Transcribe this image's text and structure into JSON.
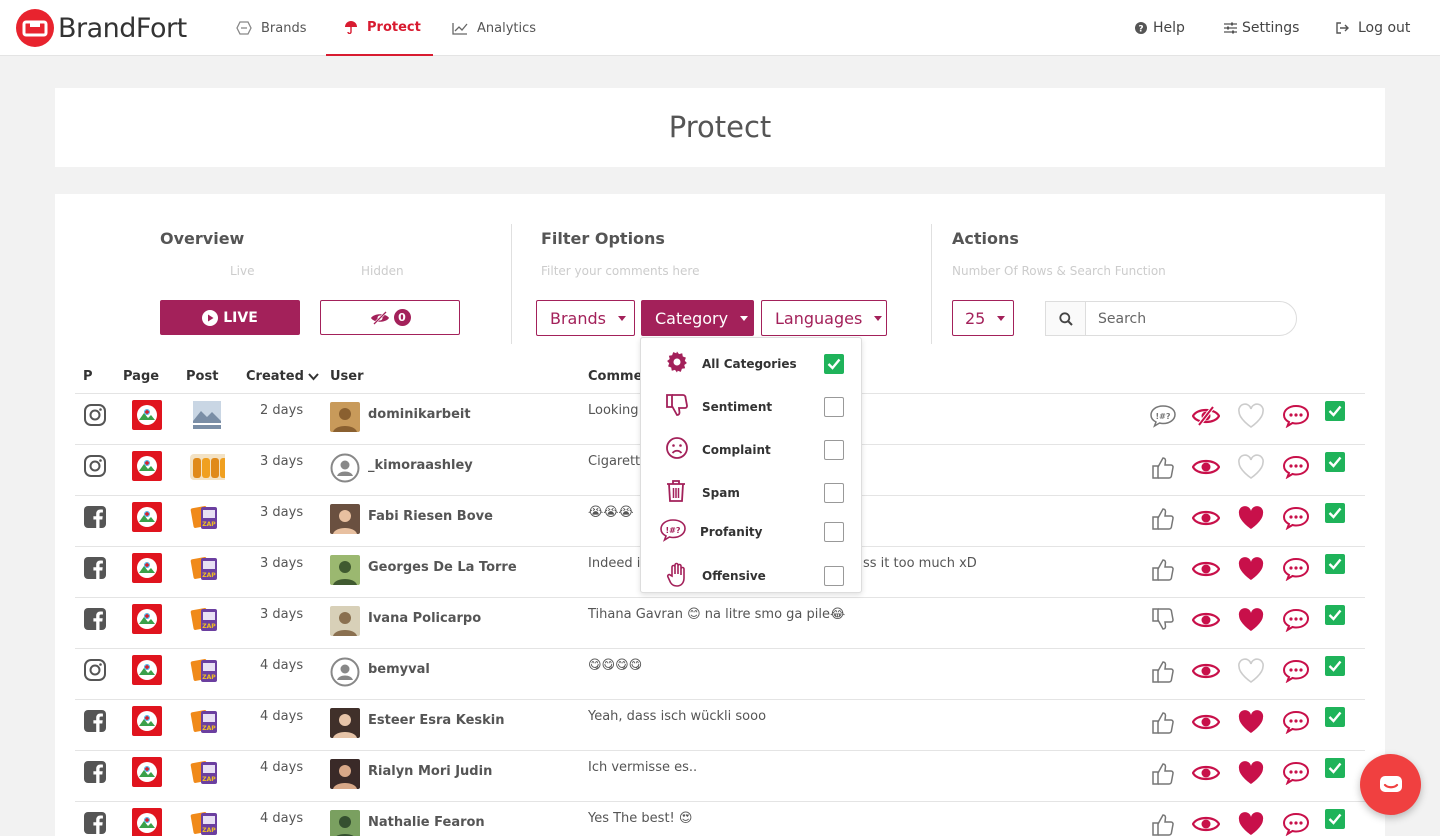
{
  "brand": {
    "name": "BrandFort"
  },
  "nav": {
    "items": [
      {
        "label": "Brands",
        "icon": "brands-icon"
      },
      {
        "label": "Protect",
        "icon": "umbrella-icon",
        "active": true
      },
      {
        "label": "Analytics",
        "icon": "chart-icon"
      }
    ],
    "right": [
      {
        "label": "Help",
        "icon": "help-icon"
      },
      {
        "label": "Settings",
        "icon": "sliders-icon"
      },
      {
        "label": "Log out",
        "icon": "logout-icon"
      }
    ]
  },
  "page": {
    "title": "Protect"
  },
  "overview": {
    "title": "Overview",
    "live_label": "Live",
    "hidden_label": "Hidden",
    "live_button": "LIVE",
    "hidden_count": "0"
  },
  "filters": {
    "title": "Filter Options",
    "subtitle": "Filter your comments here",
    "brands": "Brands",
    "category": "Category",
    "languages": "Languages"
  },
  "actions": {
    "title": "Actions",
    "subtitle": "Number Of Rows & Search Function",
    "rows": "25",
    "search_placeholder": "Search"
  },
  "category_menu": [
    {
      "label": "All Categories",
      "icon": "gear-icon",
      "checked": true
    },
    {
      "label": "Sentiment",
      "icon": "thumbs-down-icon",
      "checked": false
    },
    {
      "label": "Complaint",
      "icon": "frown-icon",
      "checked": false
    },
    {
      "label": "Spam",
      "icon": "trash-icon",
      "checked": false
    },
    {
      "label": "Profanity",
      "icon": "profanity-icon",
      "checked": false
    },
    {
      "label": "Offensive",
      "icon": "hand-icon",
      "checked": false
    }
  ],
  "table": {
    "headers": {
      "p": "P",
      "page": "Page",
      "post": "Post",
      "created": "Created",
      "user": "User",
      "comment": "Comment"
    },
    "rows": [
      {
        "platform": "instagram",
        "created": "2 days",
        "user": "dominikarbeit",
        "comment": "Looking f",
        "sentiment": "profanity",
        "liked": false,
        "hidden": true
      },
      {
        "platform": "instagram",
        "created": "3 days",
        "user": "_kimoraashley",
        "comment": "Cigarette",
        "sentiment": "up",
        "liked": false,
        "hidden": false
      },
      {
        "platform": "facebook",
        "created": "3 days",
        "user": "Fabi Riesen Bove",
        "comment": "😭😭😭",
        "sentiment": "up",
        "liked": true,
        "hidden": false
      },
      {
        "platform": "facebook",
        "created": "3 days",
        "user": "Georges De La Torre",
        "comment": "Indeed it",
        "comment_tail": "ss it too much xD",
        "sentiment": "up",
        "liked": true,
        "hidden": false
      },
      {
        "platform": "facebook",
        "created": "3 days",
        "user": "Ivana Policarpo",
        "comment": "Tihana Gavran 😊 na litre smo ga pile😂",
        "sentiment": "down",
        "liked": true,
        "hidden": false
      },
      {
        "platform": "instagram",
        "created": "4 days",
        "user": "bemyval",
        "comment": "😋😋😋😋",
        "sentiment": "up",
        "liked": false,
        "hidden": false
      },
      {
        "platform": "facebook",
        "created": "4 days",
        "user": "Esteer Esra Keskin",
        "comment": "Yeah, dass isch wückli sooo",
        "sentiment": "up",
        "liked": true,
        "hidden": false
      },
      {
        "platform": "facebook",
        "created": "4 days",
        "user": "Rialyn Mori Judin",
        "comment": "Ich vermisse es..",
        "sentiment": "up",
        "liked": true,
        "hidden": false
      },
      {
        "platform": "facebook",
        "created": "4 days",
        "user": "Nathalie Fearon",
        "comment": "Yes The best! 😍",
        "sentiment": "up",
        "liked": true,
        "hidden": false
      }
    ]
  },
  "colors": {
    "accent": "#a3215a",
    "brand_red": "#e8232e",
    "check_green": "#1fb35a",
    "heart": "#c8104a"
  }
}
